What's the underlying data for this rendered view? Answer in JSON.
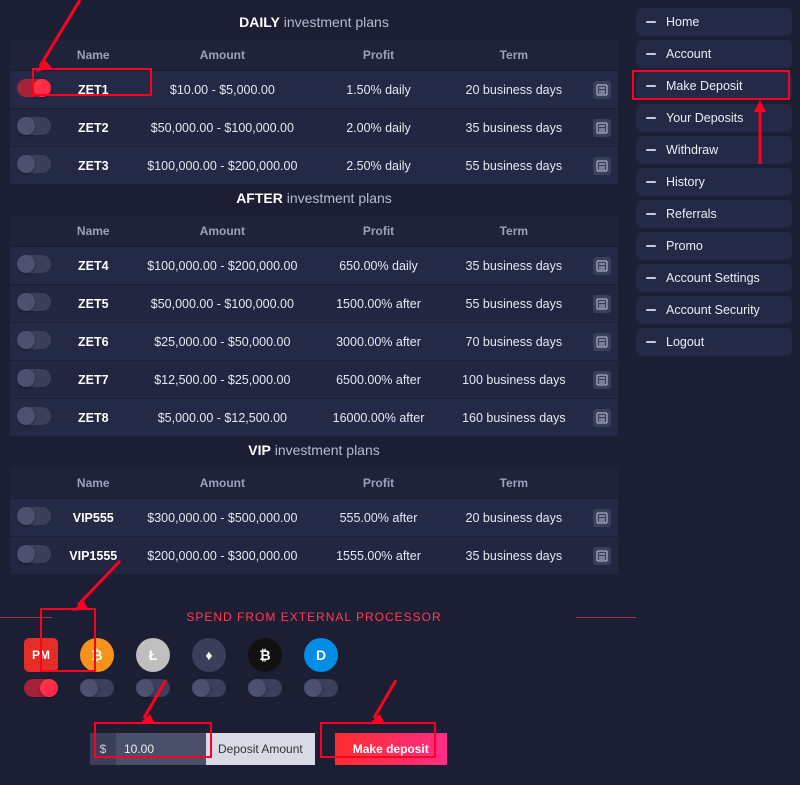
{
  "headers": {
    "name": "Name",
    "amount": "Amount",
    "profit": "Profit",
    "term": "Term"
  },
  "sections": [
    {
      "title_bold": "DAILY",
      "title_thin": "investment plans",
      "rows": [
        {
          "on": true,
          "name": "ZET1",
          "amount": "$10.00 - $5,000.00",
          "profit": "1.50% daily",
          "term": "20 business days"
        },
        {
          "on": false,
          "name": "ZET2",
          "amount": "$50,000.00 - $100,000.00",
          "profit": "2.00% daily",
          "term": "35 business days"
        },
        {
          "on": false,
          "name": "ZET3",
          "amount": "$100,000.00 - $200,000.00",
          "profit": "2.50% daily",
          "term": "55 business days"
        }
      ]
    },
    {
      "title_bold": "AFTER",
      "title_thin": "investment plans",
      "rows": [
        {
          "on": false,
          "name": "ZET4",
          "amount": "$100,000.00 - $200,000.00",
          "profit": "650.00% daily",
          "term": "35 business days"
        },
        {
          "on": false,
          "name": "ZET5",
          "amount": "$50,000.00 - $100,000.00",
          "profit": "1500.00% after",
          "term": "55 business days"
        },
        {
          "on": false,
          "name": "ZET6",
          "amount": "$25,000.00 - $50,000.00",
          "profit": "3000.00% after",
          "term": "70 business days"
        },
        {
          "on": false,
          "name": "ZET7",
          "amount": "$12,500.00 - $25,000.00",
          "profit": "6500.00% after",
          "term": "100 business days"
        },
        {
          "on": false,
          "name": "ZET8",
          "amount": "$5,000.00 - $12,500.00",
          "profit": "16000.00% after",
          "term": "160 business days"
        }
      ]
    },
    {
      "title_bold": "VIP",
      "title_thin": "investment plans",
      "rows": [
        {
          "on": false,
          "name": "VIP555",
          "amount": "$300,000.00 - $500,000.00",
          "profit": "555.00% after",
          "term": "20 business days"
        },
        {
          "on": false,
          "name": "VIP1555",
          "amount": "$200,000.00 - $300,000.00",
          "profit": "1555.00% after",
          "term": "35 business days"
        }
      ]
    }
  ],
  "sidebar": {
    "items": [
      "Home",
      "Account",
      "Make Deposit",
      "Your Deposits",
      "Withdraw",
      "History",
      "Referrals",
      "Promo",
      "Account Settings",
      "Account Security",
      "Logout"
    ]
  },
  "processors": {
    "heading": "SPEND FROM EXTERNAL PROCESSOR",
    "items": [
      {
        "id": "pm",
        "label": "PM",
        "on": true,
        "class": "pm",
        "square": true
      },
      {
        "id": "btc",
        "label": "₿",
        "on": false,
        "class": "btc"
      },
      {
        "id": "ltc",
        "label": "Ł",
        "on": false,
        "class": "ltc"
      },
      {
        "id": "eth",
        "label": "♦",
        "on": false,
        "class": "eth"
      },
      {
        "id": "bch",
        "label": "₿",
        "on": false,
        "class": "bch"
      },
      {
        "id": "dash",
        "label": "D",
        "on": false,
        "class": "dash"
      }
    ]
  },
  "deposit": {
    "currency": "$",
    "value": "10.00",
    "label": "Deposit Amount",
    "button": "Make deposit"
  }
}
